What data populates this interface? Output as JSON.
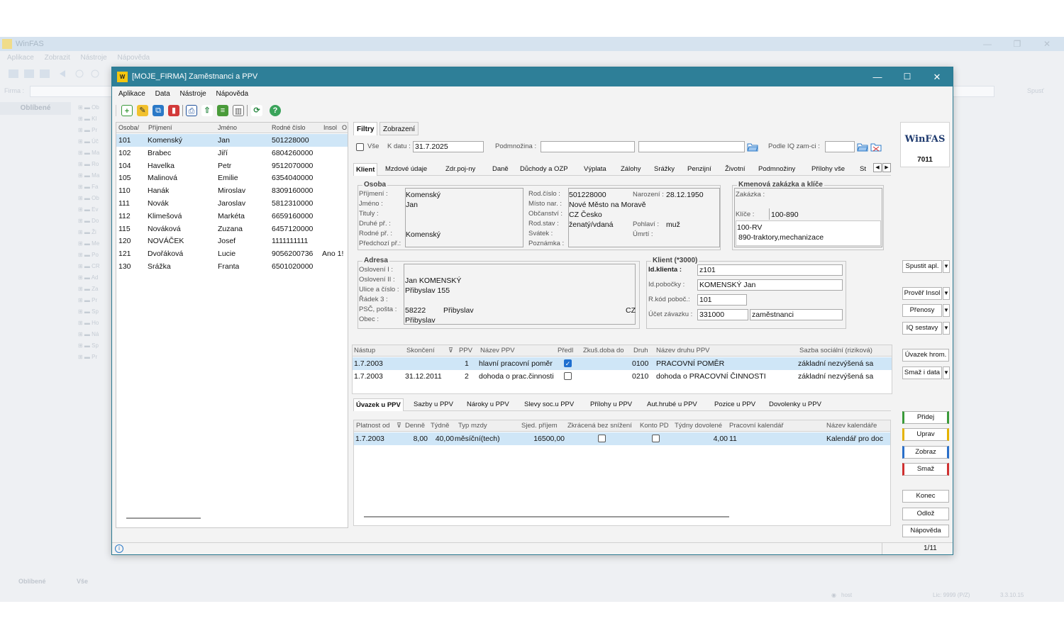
{
  "background": {
    "app_title": "WinFAS",
    "menu": [
      "Aplikace",
      "Zobrazit",
      "Nástroje",
      "Nápověda"
    ],
    "firma_label": "Firma :",
    "spust_label": "Spusť",
    "sidebar_title": "Oblíbené",
    "tree_items": [
      "Ob",
      "Kl",
      "Pr",
      "Úč",
      "Ma",
      "Ro",
      "Ma",
      "Fa",
      "Ob",
      "Ev",
      "Do",
      "Ži",
      "Me",
      "Po",
      "CR",
      "Ad",
      "Za",
      "Pr",
      "Sp",
      "Ho",
      "Ná",
      "Sp",
      "Pr"
    ],
    "footer_tabs": [
      "Oblíbené",
      "Vše"
    ],
    "status": {
      "host": "host",
      "lic": "Lic: 9999 (P/Z)",
      "version": "3.3.10.15"
    }
  },
  "window": {
    "title": "[MOJE_FIRMA] Zaměstnanci a PPV",
    "logo": "W",
    "menu": [
      "Aplikace",
      "Data",
      "Nástroje",
      "Nápověda"
    ],
    "toolbar_icons": [
      "add-icon",
      "edit-icon",
      "copy-icon",
      "delete-icon",
      "print-icon",
      "export-icon",
      "list-icon",
      "columns-icon",
      "refresh-icon",
      "help-icon"
    ]
  },
  "employees": {
    "columns": [
      "Osoba/",
      "Příjmení",
      "Jméno",
      "Rodné číslo",
      "Insol",
      "O"
    ],
    "rows": [
      {
        "id": "101",
        "surname": "Komenský",
        "name": "Jan",
        "rc": "501228000",
        "insol": ""
      },
      {
        "id": "102",
        "surname": "Brabec",
        "name": "Jiří",
        "rc": "6804260000",
        "insol": ""
      },
      {
        "id": "104",
        "surname": "Havelka",
        "name": "Petr",
        "rc": "9512070000",
        "insol": ""
      },
      {
        "id": "105",
        "surname": "Malinová",
        "name": "Emilie",
        "rc": "6354040000",
        "insol": ""
      },
      {
        "id": "110",
        "surname": "Hanák",
        "name": "Miroslav",
        "rc": "8309160000",
        "insol": ""
      },
      {
        "id": "111",
        "surname": "Novák",
        "name": "Jaroslav",
        "rc": "5812310000",
        "insol": ""
      },
      {
        "id": "112",
        "surname": "Klimešová",
        "name": "Markéta",
        "rc": "6659160000",
        "insol": ""
      },
      {
        "id": "115",
        "surname": "Nováková",
        "name": "Zuzana",
        "rc": "6457120000",
        "insol": ""
      },
      {
        "id": "120",
        "surname": "NOVÁČEK",
        "name": "Josef",
        "rc": "1111111111",
        "insol": ""
      },
      {
        "id": "121",
        "surname": "Dvořáková",
        "name": "Lucie",
        "rc": "9056200736",
        "insol": "Ano 1!"
      },
      {
        "id": "130",
        "surname": "Srážka",
        "name": "Franta",
        "rc": "6501020000",
        "insol": ""
      }
    ]
  },
  "filters": {
    "tabs": [
      "Filtry",
      "Zobrazení"
    ],
    "vse_label": "Vše",
    "kdatu_label": "K datu :",
    "kdatu_value": "31.7.2025",
    "podmnozina_label": "Podmnožina :",
    "podle_iq_label": "Podle IQ zam-ci :"
  },
  "detail_tabs": [
    "Klient",
    "Mzdové údaje",
    "Zdr.poj-ny",
    "Daně",
    "Důchody a OZP",
    "Výplata",
    "Zálohy",
    "Srážky",
    "Penzijní",
    "Životní",
    "Podmnožiny",
    "Přílohy vše",
    "St"
  ],
  "osoba": {
    "title": "Osoba",
    "labels": [
      "Příjmení :",
      "Jméno :",
      "Tituly :",
      "Druhé př. :",
      "Rodné př. :",
      "Předchozí př.:"
    ],
    "prijmeni": "Komenský",
    "jmeno": "Jan",
    "rodne_prijmeni": "Komenský",
    "labels2": [
      "Rod.číslo :",
      "Místo nar. :",
      "Občanství :",
      "Rod.stav :",
      "Svátek :",
      "Poznámka :"
    ],
    "rod_cislo": "501228000",
    "misto_nar": "Nové Město na Moravě",
    "obcanstvi": "CZ Česko",
    "rod_stav": "ženatý/vdaná",
    "narozeni_label": "Narození :",
    "narozeni": "28.12.1950",
    "pohlavi_label": "Pohlaví :",
    "pohlavi": "muž",
    "umrti_label": "Úmrtí :"
  },
  "kmenova": {
    "title": "Kmenová zakázka a klíče",
    "zakazka_label": "Zakázka :",
    "klice_label": "Klíče :",
    "klic_value": "100-890",
    "klic_rows": [
      "100-RV",
      "890-traktory,mechanizace"
    ]
  },
  "adresa": {
    "title": "Adresa",
    "labels": [
      "Oslovení I :",
      "Oslovení II :",
      "Ulice a číslo :",
      "Řádek 3 :",
      "PSČ, pošta :",
      "Obec :"
    ],
    "osloveni2": "Jan KOMENSKÝ",
    "ulice": "Přibyslav 155",
    "psc": "58222",
    "posta": "Přibyslav",
    "stat": "CZ",
    "obec": "Přibyslav"
  },
  "klient": {
    "title": "Klient (*3000)",
    "id_label": "Id.klienta :",
    "id_value": "z101",
    "pobocka_label": "Id.pobočky :",
    "pobocka_value": "KOMENSKÝ Jan",
    "rkod_label": "R.kód poboč.:",
    "rkod_value": "101",
    "ucet_label": "Účet závazku :",
    "ucet_value": "331000",
    "ucet_name": "zaměstnanci"
  },
  "ppv": {
    "columns": [
      "Nástup",
      "Skončení",
      "",
      "PPV",
      "Název PPV",
      "Předl",
      "Zkuš.doba do",
      "Druh",
      "Název druhu PPV",
      "Sazba sociální (riziková)"
    ],
    "rows": [
      {
        "nastup": "1.7.2003",
        "skonceni": "",
        "ppv": "1",
        "nazev": "hlavní pracovní poměr",
        "predl": true,
        "druh": "0100",
        "druh_nazev": "PRACOVNÍ POMĚR",
        "sazba": "základní nezvýšená sa"
      },
      {
        "nastup": "1.7.2003",
        "skonceni": "31.12.2011",
        "ppv": "2",
        "nazev": "dohoda o prac.činnosti",
        "predl": false,
        "druh": "0210",
        "druh_nazev": "dohoda o PRACOVNÍ ČINNOSTI",
        "sazba": "základní nezvýšená sa"
      }
    ]
  },
  "ppv_tabs": [
    "Úvazek u PPV",
    "Sazby u PPV",
    "Nároky u PPV",
    "Slevy soc.u PPV",
    "Přílohy u PPV",
    "Aut.hrubé u PPV",
    "Pozice u PPV",
    "Dovolenky u PPV"
  ],
  "uvazek": {
    "columns": [
      "Platnost od",
      "Denně",
      "Týdně",
      "Typ mzdy",
      "Sjed. příjem",
      "Zkrácená bez snížení",
      "Konto PD",
      "Týdny dovolené",
      "Pracovní kalendář",
      "Název kalendáře"
    ],
    "rows": [
      {
        "platnost": "1.7.2003",
        "denne": "8,00",
        "tydne": "40,00",
        "typ": "měsíční(tech)",
        "prijem": "16500,00",
        "zkracena": false,
        "konto": false,
        "tydny": "4,00",
        "kalendar": "11",
        "nazev_kal": "Kalendář pro doc"
      }
    ]
  },
  "sidebar": {
    "brand": "WinFAS",
    "brand_num": "7011",
    "spustit": "Spustit apl.",
    "prover": "Prověř Insol",
    "prenosy": "Přenosy",
    "iq": "IQ sestavy",
    "uvazek": "Úvazek hrom.",
    "smaz_data": "Smaž i data",
    "pridej": "Přidej",
    "uprav": "Uprav",
    "zobraz": "Zobraz",
    "smaz": "Smaž",
    "konec": "Konec",
    "odloz": "Odlož",
    "napoveda": "Nápověda"
  },
  "status": {
    "info": "i",
    "page": "1/11"
  },
  "colors": {
    "title_bar": "#2e7f98",
    "selection": "#cfe6f7",
    "pridej_accent": "#3a9a3a",
    "uprav_accent": "#e5b300",
    "zobraz_accent": "#2a6fc9",
    "smaz_accent": "#d03030"
  }
}
